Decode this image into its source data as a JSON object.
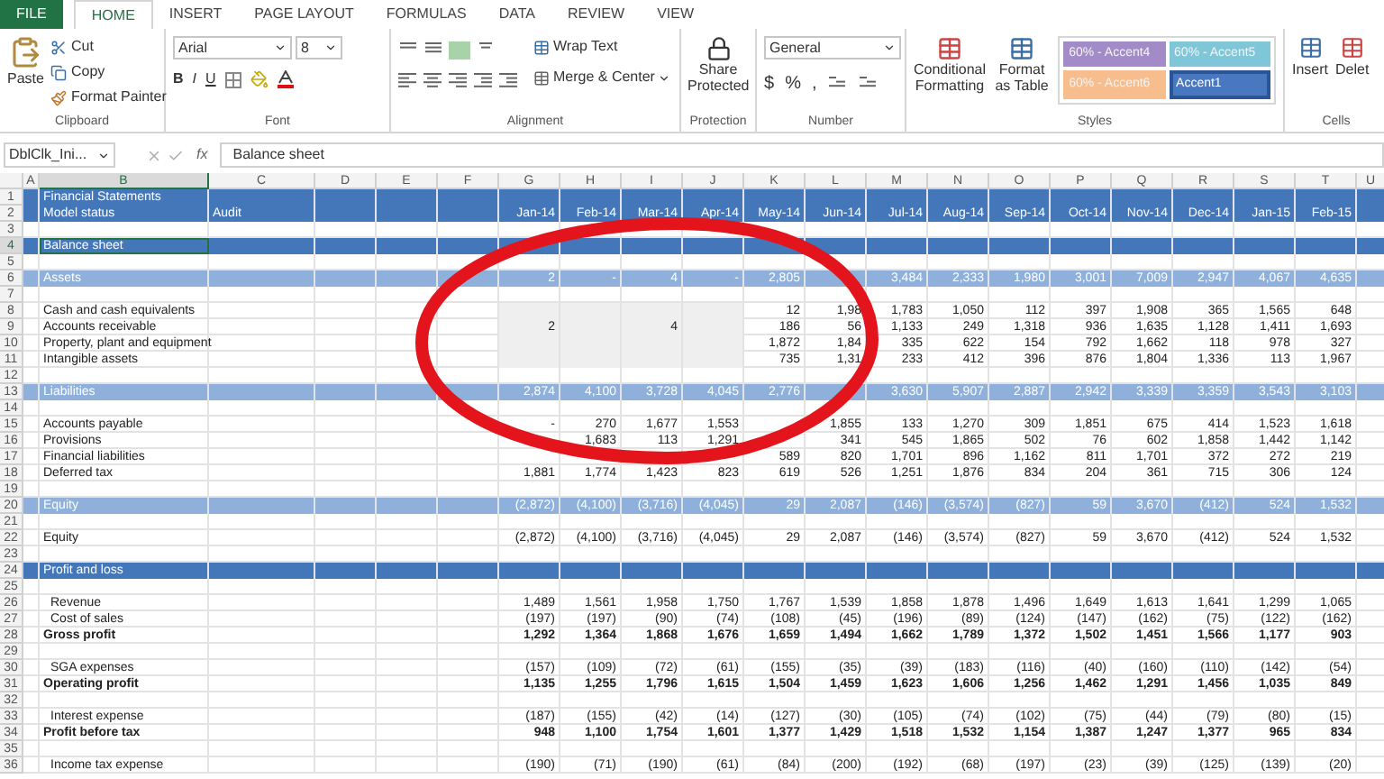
{
  "tabs": [
    {
      "label": "FILE",
      "kind": "file",
      "selected": false
    },
    {
      "label": "HOME",
      "kind": "tab",
      "selected": true
    },
    {
      "label": "INSERT",
      "kind": "tab",
      "selected": false
    },
    {
      "label": "PAGE LAYOUT",
      "kind": "tab",
      "selected": false
    },
    {
      "label": "FORMULAS",
      "kind": "tab",
      "selected": false
    },
    {
      "label": "DATA",
      "kind": "tab",
      "selected": false
    },
    {
      "label": "REVIEW",
      "kind": "tab",
      "selected": false
    },
    {
      "label": "VIEW",
      "kind": "tab",
      "selected": false
    }
  ],
  "ribbon": {
    "clipboard": {
      "paste": "Paste",
      "cut": "Cut",
      "copy": "Copy",
      "format_painter": "Format Painter",
      "label": "Clipboard"
    },
    "font": {
      "family": "Arial",
      "size": "8",
      "bold": "B",
      "italic": "I",
      "underline": "U",
      "label": "Font"
    },
    "alignment": {
      "wrap_text": "Wrap Text",
      "merge": "Merge & Center",
      "label": "Alignment"
    },
    "protection": {
      "button": "Share Protected",
      "label": "Protection"
    },
    "number": {
      "format": "General",
      "currency": "$",
      "percent": "%",
      "comma": ",",
      "label": "Number"
    },
    "styles": {
      "conditional": "Conditional Formatting",
      "format_table": "Format as Table",
      "label": "Styles",
      "chips": [
        {
          "label": "60% - Accent4",
          "color": "#a28bc6",
          "selected": false
        },
        {
          "label": "60% - Accent5",
          "color": "#7fc6d8",
          "selected": false
        },
        {
          "label": "60% - Accent6",
          "color": "#f7bd8d",
          "selected": false
        },
        {
          "label": "Accent1",
          "color": "#4a78c0",
          "selected": true
        }
      ]
    },
    "cells": {
      "insert": "Insert",
      "delete": "Delet",
      "label": "Cells"
    }
  },
  "formula_bar": {
    "name_box": "DblClk_Ini...",
    "fx": "fx",
    "value": "Balance sheet"
  },
  "columns": [
    {
      "letter": "A",
      "selected": false
    },
    {
      "letter": "B",
      "selected": true
    },
    {
      "letter": "C",
      "selected": false
    },
    {
      "letter": "D",
      "selected": false
    },
    {
      "letter": "E",
      "selected": false
    },
    {
      "letter": "F",
      "selected": false
    },
    {
      "letter": "G",
      "selected": false
    },
    {
      "letter": "H",
      "selected": false
    },
    {
      "letter": "I",
      "selected": false
    },
    {
      "letter": "J",
      "selected": false
    },
    {
      "letter": "K",
      "selected": false
    },
    {
      "letter": "L",
      "selected": false
    },
    {
      "letter": "M",
      "selected": false
    },
    {
      "letter": "N",
      "selected": false
    },
    {
      "letter": "O",
      "selected": false
    },
    {
      "letter": "P",
      "selected": false
    },
    {
      "letter": "Q",
      "selected": false
    },
    {
      "letter": "R",
      "selected": false
    },
    {
      "letter": "S",
      "selected": false
    },
    {
      "letter": "T",
      "selected": false
    },
    {
      "letter": "U",
      "selected": false
    }
  ],
  "rows": [
    {
      "num": "1",
      "kind": "title",
      "label": "Financial Statements",
      "selected": false
    },
    {
      "num": "2",
      "kind": "title",
      "label": "Model status",
      "label_2": "Audit",
      "selected": false,
      "values": {
        "1": "Jan-14",
        "2": "Feb-14",
        "3": "Mar-14",
        "4": "Apr-14",
        "5": "May-14",
        "6": "Jun-14",
        "7": "Jul-14",
        "8": "Aug-14",
        "9": "Sep-14",
        "10": "Oct-14",
        "11": "Nov-14",
        "12": "Dec-14",
        "13": "Jan-15",
        "14": "Feb-15"
      }
    },
    {
      "num": "3",
      "kind": "blank"
    },
    {
      "num": "4",
      "kind": "title",
      "label": "Balance sheet",
      "selected": true
    },
    {
      "num": "5",
      "kind": "blank"
    },
    {
      "num": "6",
      "kind": "section",
      "label": "Assets",
      "selected": false,
      "values": {
        "1": "2",
        "2": "-",
        "3": "4",
        "4": "-",
        "5": "2,805",
        "7": "3,484",
        "8": "2,333",
        "9": "1,980",
        "10": "3,001",
        "11": "7,009",
        "12": "2,947",
        "13": "4,067",
        "14": "4,635"
      }
    },
    {
      "num": "7",
      "kind": "blank"
    },
    {
      "num": "8",
      "kind": "item",
      "label": "Cash and cash equivalents",
      "selected": false,
      "shaded": true,
      "values": {
        "5": "12",
        "6": "1,98",
        "7": "1,783",
        "8": "1,050",
        "9": "112",
        "10": "397",
        "11": "1,908",
        "12": "365",
        "13": "1,565",
        "14": "648"
      }
    },
    {
      "num": "9",
      "kind": "item",
      "label": "Accounts receivable",
      "selected": false,
      "shaded": true,
      "values": {
        "1": "2",
        "3": "4",
        "5": "186",
        "6": "56",
        "7": "1,133",
        "8": "249",
        "9": "1,318",
        "10": "936",
        "11": "1,635",
        "12": "1,128",
        "13": "1,411",
        "14": "1,693"
      }
    },
    {
      "num": "10",
      "kind": "item",
      "label": "Property, plant and equipment",
      "selected": false,
      "shaded": true,
      "values": {
        "5": "1,872",
        "6": "1,84",
        "7": "335",
        "8": "622",
        "9": "154",
        "10": "792",
        "11": "1,662",
        "12": "118",
        "13": "978",
        "14": "327"
      }
    },
    {
      "num": "11",
      "kind": "item",
      "label": "Intangible assets",
      "selected": false,
      "shaded": true,
      "values": {
        "5": "735",
        "6": "1,31",
        "7": "233",
        "8": "412",
        "9": "396",
        "10": "876",
        "11": "1,804",
        "12": "1,336",
        "13": "113",
        "14": "1,967"
      }
    },
    {
      "num": "12",
      "kind": "blank"
    },
    {
      "num": "13",
      "kind": "section",
      "label": "Liabilities",
      "selected": false,
      "values": {
        "1": "2,874",
        "2": "4,100",
        "3": "3,728",
        "4": "4,045",
        "5": "2,776",
        "7": "3,630",
        "8": "5,907",
        "9": "2,887",
        "10": "2,942",
        "11": "3,339",
        "12": "3,359",
        "13": "3,543",
        "14": "3,103"
      }
    },
    {
      "num": "14",
      "kind": "blank"
    },
    {
      "num": "15",
      "kind": "item",
      "label": "Accounts payable",
      "selected": false,
      "shaded": false,
      "values": {
        "1": "-",
        "2": "270",
        "3": "1,677",
        "4": "1,553",
        "6": "1,855",
        "7": "133",
        "8": "1,270",
        "9": "309",
        "10": "1,851",
        "11": "675",
        "12": "414",
        "13": "1,523",
        "14": "1,618"
      }
    },
    {
      "num": "16",
      "kind": "item",
      "label": "Provisions",
      "selected": false,
      "shaded": false,
      "values": {
        "2": "1,683",
        "3": "113",
        "4": "1,291",
        "6": "341",
        "7": "545",
        "8": "1,865",
        "9": "502",
        "10": "76",
        "11": "602",
        "12": "1,858",
        "13": "1,442",
        "14": "1,142"
      }
    },
    {
      "num": "17",
      "kind": "item",
      "label": "Financial liabilities",
      "selected": false,
      "shaded": false,
      "values": {
        "5": "589",
        "6": "820",
        "7": "1,701",
        "8": "896",
        "9": "1,162",
        "10": "811",
        "11": "1,701",
        "12": "372",
        "13": "272",
        "14": "219"
      }
    },
    {
      "num": "18",
      "kind": "item",
      "label": "Deferred tax",
      "selected": false,
      "shaded": false,
      "values": {
        "1": "1,881",
        "2": "1,774",
        "3": "1,423",
        "4": "823",
        "5": "619",
        "6": "526",
        "7": "1,251",
        "8": "1,876",
        "9": "834",
        "10": "204",
        "11": "361",
        "12": "715",
        "13": "306",
        "14": "124"
      }
    },
    {
      "num": "19",
      "kind": "blank"
    },
    {
      "num": "20",
      "kind": "section",
      "label": "Equity",
      "selected": false,
      "values": {
        "1": "(2,872)",
        "2": "(4,100)",
        "3": "(3,716)",
        "4": "(4,045)",
        "5": "29",
        "6": "2,087",
        "7": "(146)",
        "8": "(3,574)",
        "9": "(827)",
        "10": "59",
        "11": "3,670",
        "12": "(412)",
        "13": "524",
        "14": "1,532"
      }
    },
    {
      "num": "21",
      "kind": "blank"
    },
    {
      "num": "22",
      "kind": "item",
      "label": "Equity",
      "selected": false,
      "shaded": false,
      "values": {
        "1": "(2,872)",
        "2": "(4,100)",
        "3": "(3,716)",
        "4": "(4,045)",
        "5": "29",
        "6": "2,087",
        "7": "(146)",
        "8": "(3,574)",
        "9": "(827)",
        "10": "59",
        "11": "3,670",
        "12": "(412)",
        "13": "524",
        "14": "1,532"
      }
    },
    {
      "num": "23",
      "kind": "blank"
    },
    {
      "num": "24",
      "kind": "title",
      "label": "Profit and loss",
      "selected": false
    },
    {
      "num": "25",
      "kind": "blank"
    },
    {
      "num": "26",
      "kind": "sub",
      "label": "Revenue",
      "selected": false,
      "values": {
        "1": "1,489",
        "2": "1,561",
        "3": "1,958",
        "4": "1,750",
        "5": "1,767",
        "6": "1,539",
        "7": "1,858",
        "8": "1,878",
        "9": "1,496",
        "10": "1,649",
        "11": "1,613",
        "12": "1,641",
        "13": "1,299",
        "14": "1,065"
      }
    },
    {
      "num": "27",
      "kind": "sub",
      "label": "Cost of sales",
      "selected": false,
      "values": {
        "1": "(197)",
        "2": "(197)",
        "3": "(90)",
        "4": "(74)",
        "5": "(108)",
        "6": "(45)",
        "7": "(196)",
        "8": "(89)",
        "9": "(124)",
        "10": "(147)",
        "11": "(162)",
        "12": "(75)",
        "13": "(122)",
        "14": "(162)"
      }
    },
    {
      "num": "28",
      "kind": "total",
      "label": "Gross profit",
      "selected": false,
      "values": {
        "1": "1,292",
        "2": "1,364",
        "3": "1,868",
        "4": "1,676",
        "5": "1,659",
        "6": "1,494",
        "7": "1,662",
        "8": "1,789",
        "9": "1,372",
        "10": "1,502",
        "11": "1,451",
        "12": "1,566",
        "13": "1,177",
        "14": "903"
      }
    },
    {
      "num": "29",
      "kind": "blank"
    },
    {
      "num": "30",
      "kind": "sub",
      "label": "SGA expenses",
      "selected": false,
      "values": {
        "1": "(157)",
        "2": "(109)",
        "3": "(72)",
        "4": "(61)",
        "5": "(155)",
        "6": "(35)",
        "7": "(39)",
        "8": "(183)",
        "9": "(116)",
        "10": "(40)",
        "11": "(160)",
        "12": "(110)",
        "13": "(142)",
        "14": "(54)"
      }
    },
    {
      "num": "31",
      "kind": "total",
      "label": "Operating profit",
      "selected": false,
      "values": {
        "1": "1,135",
        "2": "1,255",
        "3": "1,796",
        "4": "1,615",
        "5": "1,504",
        "6": "1,459",
        "7": "1,623",
        "8": "1,606",
        "9": "1,256",
        "10": "1,462",
        "11": "1,291",
        "12": "1,456",
        "13": "1,035",
        "14": "849"
      }
    },
    {
      "num": "32",
      "kind": "blank"
    },
    {
      "num": "33",
      "kind": "sub",
      "label": "Interest expense",
      "selected": false,
      "values": {
        "1": "(187)",
        "2": "(155)",
        "3": "(42)",
        "4": "(14)",
        "5": "(127)",
        "6": "(30)",
        "7": "(105)",
        "8": "(74)",
        "9": "(102)",
        "10": "(75)",
        "11": "(44)",
        "12": "(79)",
        "13": "(80)",
        "14": "(15)"
      }
    },
    {
      "num": "34",
      "kind": "total",
      "label": "Profit before tax",
      "selected": false,
      "values": {
        "1": "948",
        "2": "1,100",
        "3": "1,754",
        "4": "1,601",
        "5": "1,377",
        "6": "1,429",
        "7": "1,518",
        "8": "1,532",
        "9": "1,154",
        "10": "1,387",
        "11": "1,247",
        "12": "1,377",
        "13": "965",
        "14": "834"
      }
    },
    {
      "num": "35",
      "kind": "blank"
    },
    {
      "num": "36",
      "kind": "sub",
      "label": "Income tax expense",
      "selected": false,
      "values": {
        "1": "(190)",
        "2": "(71)",
        "3": "(190)",
        "4": "(61)",
        "5": "(84)",
        "6": "(200)",
        "7": "(192)",
        "8": "(68)",
        "9": "(197)",
        "10": "(23)",
        "11": "(39)",
        "12": "(125)",
        "13": "(139)",
        "14": "(20)"
      }
    }
  ],
  "overlay": {
    "kind": "ellipse"
  }
}
